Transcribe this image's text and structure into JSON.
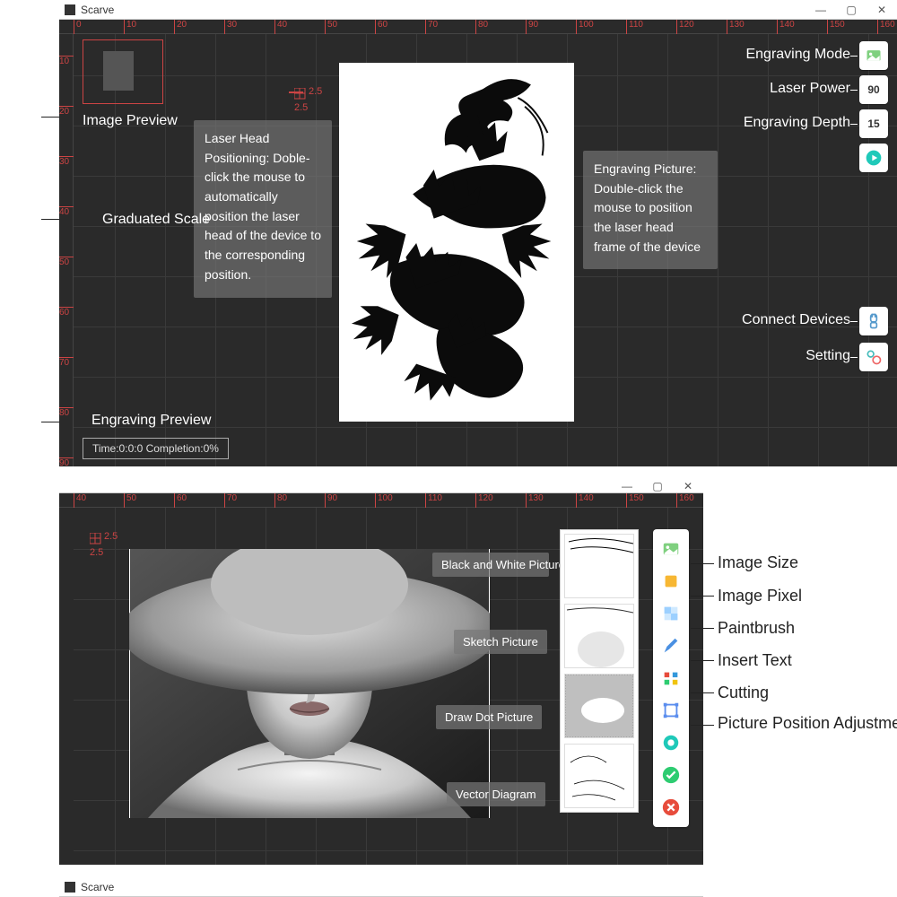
{
  "app": {
    "title": "Scarve"
  },
  "win_controls": {
    "min": "—",
    "max": "▢",
    "close": "✕"
  },
  "top": {
    "ruler_ticks_h": [
      "0",
      "10",
      "20",
      "30",
      "40",
      "50",
      "60",
      "70",
      "80",
      "90",
      "100",
      "110",
      "120",
      "130",
      "140",
      "150",
      "160"
    ],
    "ruler_ticks_v": [
      "10",
      "20",
      "30",
      "40",
      "50",
      "60",
      "70",
      "80",
      "90"
    ],
    "labels": {
      "image_preview": "Image Preview",
      "graduated_scale": "Graduated Scale",
      "engraving_preview": "Engraving Preview",
      "engraving_mode": "Engraving Mode",
      "laser_power": "Laser Power",
      "engraving_depth": "Engraving Depth",
      "connect_devices": "Connect Devices",
      "setting": "Setting"
    },
    "crosshair": {
      "xy": "2.5"
    },
    "tooltip_left": "Laser Head Positioning: Doble-click the mouse to automatically position the laser head of the device to the corresponding position.",
    "tooltip_right": "Engraving Picture: Double-click the mouse to position the laser head frame of the device",
    "laser_power_value": "90",
    "engraving_depth_value": "15",
    "status": "Time:0:0:0  Completion:0%"
  },
  "bottom": {
    "ruler_ticks_h": [
      "40",
      "50",
      "60",
      "70",
      "80",
      "90",
      "100",
      "110",
      "120",
      "130",
      "140",
      "150",
      "160"
    ],
    "crosshair": {
      "xy": "2.5"
    },
    "options": {
      "bw": "Black and White Picture",
      "sketch": "Sketch Picture",
      "dot": "Draw Dot Picture",
      "vector": "Vector Diagram"
    },
    "tool_labels": {
      "image_size": "Image Size",
      "image_pixel": "Image Pixel",
      "paintbrush": "Paintbrush",
      "insert_text": "Insert Text",
      "cutting": "Cutting",
      "picture_pos": "Picture Position Adjustment"
    }
  }
}
